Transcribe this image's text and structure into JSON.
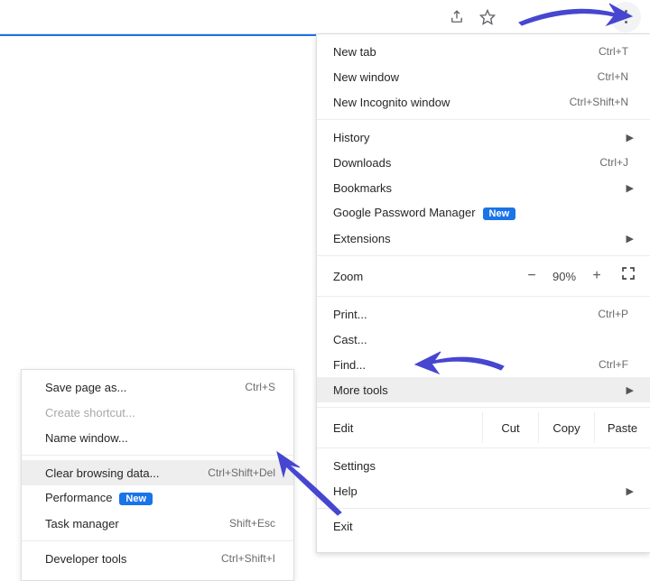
{
  "toolbar": {
    "share_icon": "share-icon",
    "star_icon": "star-icon",
    "kebab_icon": "menu-kebab-icon"
  },
  "main_menu": {
    "new_tab": {
      "label": "New tab",
      "shortcut": "Ctrl+T"
    },
    "new_window": {
      "label": "New window",
      "shortcut": "Ctrl+N"
    },
    "incognito": {
      "label": "New Incognito window",
      "shortcut": "Ctrl+Shift+N"
    },
    "history": {
      "label": "History",
      "has_submenu": true
    },
    "downloads": {
      "label": "Downloads",
      "shortcut": "Ctrl+J"
    },
    "bookmarks": {
      "label": "Bookmarks",
      "has_submenu": true
    },
    "password_mgr": {
      "label": "Google Password Manager",
      "badge": "New"
    },
    "extensions": {
      "label": "Extensions",
      "has_submenu": true
    },
    "zoom": {
      "label": "Zoom",
      "minus": "−",
      "pct": "90%",
      "plus": "+"
    },
    "print": {
      "label": "Print...",
      "shortcut": "Ctrl+P"
    },
    "cast": {
      "label": "Cast..."
    },
    "find": {
      "label": "Find...",
      "shortcut": "Ctrl+F"
    },
    "more_tools": {
      "label": "More tools",
      "has_submenu": true
    },
    "edit": {
      "label": "Edit",
      "cut": "Cut",
      "copy": "Copy",
      "paste": "Paste"
    },
    "settings": {
      "label": "Settings"
    },
    "help": {
      "label": "Help",
      "has_submenu": true
    },
    "exit": {
      "label": "Exit"
    }
  },
  "more_tools_menu": {
    "save_page": {
      "label": "Save page as...",
      "shortcut": "Ctrl+S"
    },
    "create_sc": {
      "label": "Create shortcut...",
      "disabled": true
    },
    "name_win": {
      "label": "Name window..."
    },
    "clear_data": {
      "label": "Clear browsing data...",
      "shortcut": "Ctrl+Shift+Del"
    },
    "performance": {
      "label": "Performance",
      "badge": "New"
    },
    "task_mgr": {
      "label": "Task manager",
      "shortcut": "Shift+Esc"
    },
    "dev_tools": {
      "label": "Developer tools",
      "shortcut": "Ctrl+Shift+I"
    }
  },
  "annotation_color": "#4646d1"
}
